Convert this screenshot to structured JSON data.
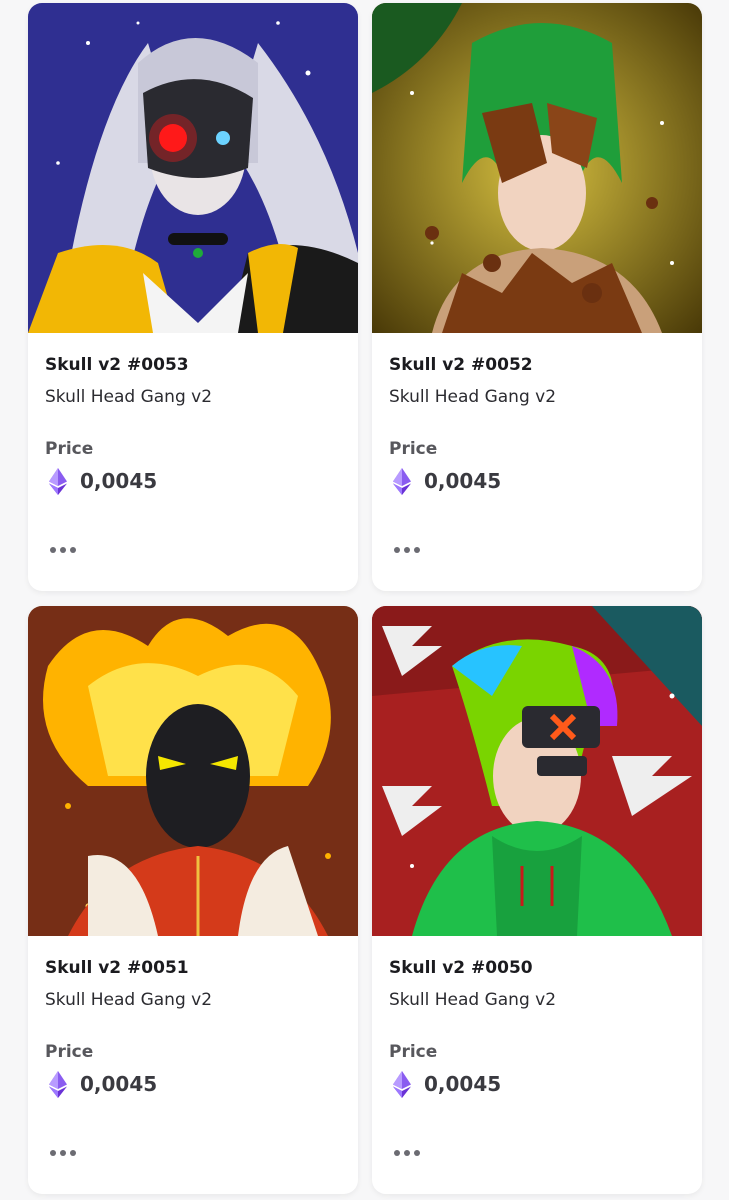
{
  "grid": {
    "items": [
      {
        "name": "Skull v2 #0053",
        "collection": "Skull Head Gang v2",
        "price_label": "Price",
        "price": "0,0045",
        "currency_icon": "ethereum-icon",
        "art_theme": {
          "bg": "#3a3aa8",
          "hair": "#d9d9e6",
          "accent": "#ff1a1a",
          "clothing": "#f2b705"
        }
      },
      {
        "name": "Skull v2 #0052",
        "collection": "Skull Head Gang v2",
        "price_label": "Price",
        "price": "0,0045",
        "currency_icon": "ethereum-icon",
        "art_theme": {
          "bg": "#7a6a10",
          "hair": "#1f9e3a",
          "accent": "#7a3a12",
          "clothing": "#c9a07a"
        }
      },
      {
        "name": "Skull v2 #0051",
        "collection": "Skull Head Gang v2",
        "price_label": "Price",
        "price": "0,0045",
        "currency_icon": "ethereum-icon",
        "art_theme": {
          "bg": "#6a2a10",
          "hair": "#ffb300",
          "accent": "#f5e700",
          "clothing": "#d43a1a"
        }
      },
      {
        "name": "Skull v2 #0050",
        "collection": "Skull Head Gang v2",
        "price_label": "Price",
        "price": "0,0045",
        "currency_icon": "ethereum-icon",
        "art_theme": {
          "bg": "#a82020",
          "hair": "#7ad400",
          "accent": "#ff5a1a",
          "clothing": "#1fbf4a"
        }
      }
    ]
  },
  "colors": {
    "page_bg": "#f7f7f8",
    "card_bg": "#ffffff",
    "title": "#1b1b1f",
    "muted": "#6b6b72",
    "eth_purple": "#7b3fe4"
  }
}
